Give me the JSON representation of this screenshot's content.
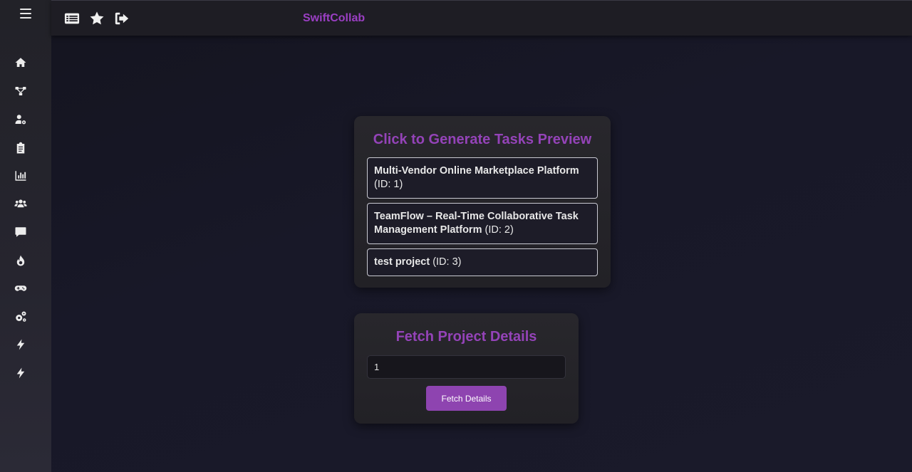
{
  "app": {
    "title": "SwiftCollab"
  },
  "sidebar": {
    "items": [
      {
        "icon": "home-icon"
      },
      {
        "icon": "sitemap-icon"
      },
      {
        "icon": "user-settings-icon"
      },
      {
        "icon": "clipboard-icon"
      },
      {
        "icon": "chart-bar-icon"
      },
      {
        "icon": "users-icon"
      },
      {
        "icon": "comment-icon"
      },
      {
        "icon": "fire-icon"
      },
      {
        "icon": "gamepad-icon"
      },
      {
        "icon": "cogs-icon"
      },
      {
        "icon": "bolt-icon"
      },
      {
        "icon": "bolt-icon"
      }
    ]
  },
  "topbar": {
    "icons": [
      "list-icon",
      "star-icon",
      "sign-out-icon"
    ]
  },
  "tasks_preview": {
    "title": "Click to Generate Tasks Preview",
    "projects": [
      {
        "name": "Multi-Vendor Online Marketplace Platform",
        "id_label": "(ID: 1)"
      },
      {
        "name": "TeamFlow – Real-Time Collaborative Task Management Platform",
        "id_label": "(ID: 2)"
      },
      {
        "name": "test project",
        "id_label": "(ID: 3)"
      }
    ]
  },
  "fetch_details": {
    "title": "Fetch Project Details",
    "input_value": "1",
    "button_label": "Fetch Details"
  },
  "colors": {
    "accent": "#9443b8",
    "button": "#8e44b0"
  }
}
